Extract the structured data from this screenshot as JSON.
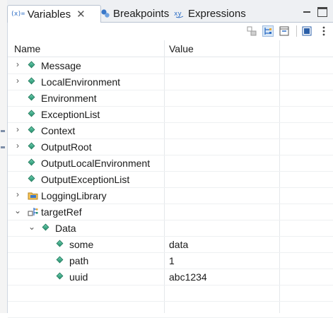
{
  "tabs": [
    {
      "label": "Variables",
      "icon": "variables-icon",
      "active": true
    },
    {
      "label": "Breakpoints",
      "icon": "breakpoints-icon",
      "active": false
    },
    {
      "label": "Expressions",
      "icon": "expressions-icon",
      "active": false
    }
  ],
  "variables_icon_text": "(x)=",
  "close_glyph": "✕",
  "columns": {
    "name": "Name",
    "value": "Value"
  },
  "rows": [
    {
      "name": "Message",
      "value": "",
      "expander": "›",
      "icon": "variable-icon"
    },
    {
      "name": "LocalEnvironment",
      "value": "",
      "expander": "›",
      "icon": "variable-icon"
    },
    {
      "name": "Environment",
      "value": "",
      "expander": "",
      "icon": "variable-icon"
    },
    {
      "name": "ExceptionList",
      "value": "",
      "expander": "",
      "icon": "variable-icon"
    },
    {
      "name": "Context",
      "value": "",
      "expander": "›",
      "icon": "variable-icon"
    },
    {
      "name": "OutputRoot",
      "value": "",
      "expander": "›",
      "icon": "variable-icon"
    },
    {
      "name": "OutputLocalEnvironment",
      "value": "",
      "expander": "",
      "icon": "variable-icon"
    },
    {
      "name": "OutputExceptionList",
      "value": "",
      "expander": "",
      "icon": "variable-icon"
    },
    {
      "name": "LoggingLibrary",
      "value": "",
      "expander": "›",
      "icon": "library-folder-icon"
    },
    {
      "name": "targetRef",
      "value": "",
      "expander": "⌄",
      "icon": "reference-icon"
    },
    {
      "name": "Data",
      "value": "",
      "expander": "⌄",
      "icon": "variable-icon"
    },
    {
      "name": "some",
      "value": "data",
      "expander": "",
      "icon": "variable-icon"
    },
    {
      "name": "path",
      "value": "1",
      "expander": "",
      "icon": "variable-icon"
    },
    {
      "name": "uuid",
      "value": "abc1234",
      "expander": "",
      "icon": "variable-icon"
    },
    {
      "name": "",
      "value": "",
      "expander": "",
      "icon": ""
    },
    {
      "name": "",
      "value": "",
      "expander": "",
      "icon": ""
    }
  ],
  "colors": {
    "accent": "#2b6cc4",
    "variable_icon": "#1f8f6a",
    "folder": "#e8a93a"
  }
}
